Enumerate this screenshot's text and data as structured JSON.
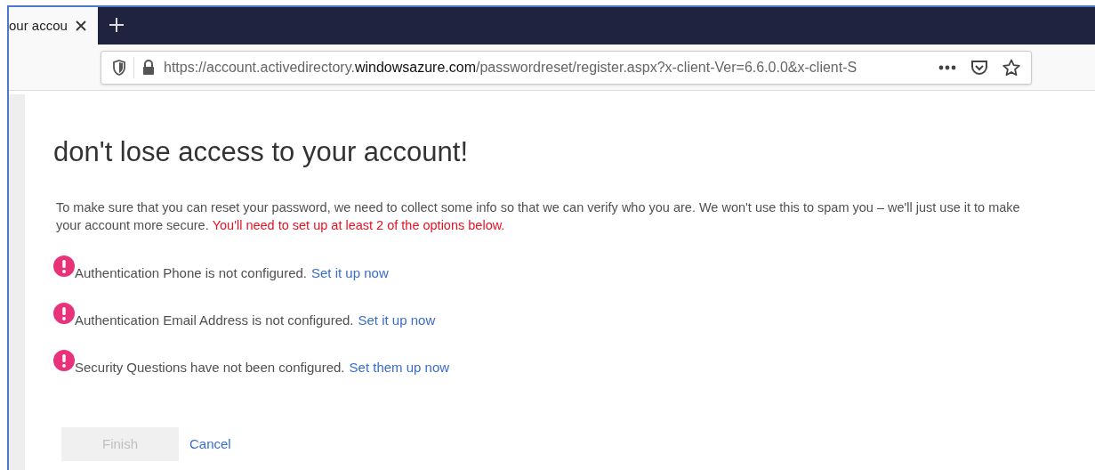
{
  "browser": {
    "tab": {
      "title": "our accou",
      "selected": true
    },
    "url": {
      "prefix": "https://account.activedirectory.",
      "domain": "windowsazure.com",
      "path": "/passwordreset/register.aspx?x-client-Ver=6.6.0.0&x-client-S"
    }
  },
  "page": {
    "heading": "don't lose access to your account!",
    "intro_lines": [
      "To make sure that you can reset your password, we need to collect some info so that we can verify who you are. We won't use this to spam you – we'll just use it to make",
      "your account more secure."
    ],
    "warning": "You'll need to set up at least 2 of the options below.",
    "items": [
      {
        "text": "Authentication Phone is not configured.",
        "link": "Set it up now"
      },
      {
        "text": "Authentication Email Address is not configured.",
        "link": "Set it up now"
      },
      {
        "text": "Security Questions have not been configured.",
        "link": "Set them up now"
      }
    ],
    "finish": {
      "label": "Finish",
      "disabled": true
    },
    "cancel": "Cancel"
  }
}
